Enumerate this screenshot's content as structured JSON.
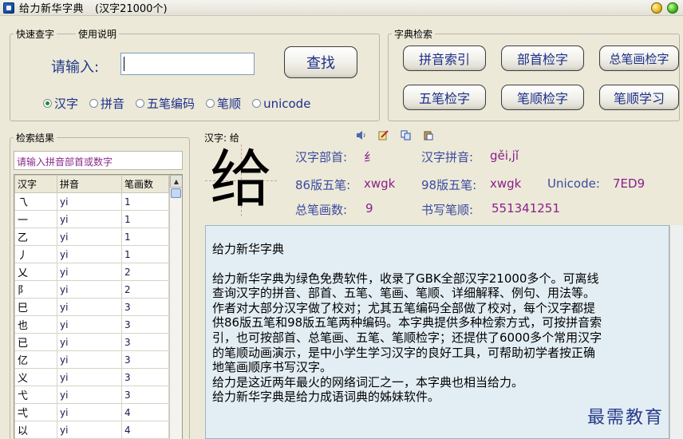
{
  "window": {
    "title": "给力新华字典",
    "subtitle": "(汉字21000个)"
  },
  "quick_search": {
    "group_label": "快速查字",
    "help_label": "使用说明",
    "input_label": "请输入:",
    "input_value": "",
    "search_button": "查找",
    "modes": [
      {
        "label": "汉字",
        "selected": true
      },
      {
        "label": "拼音",
        "selected": false
      },
      {
        "label": "五笔编码",
        "selected": false
      },
      {
        "label": "笔顺",
        "selected": false
      },
      {
        "label": "unicode",
        "selected": false
      }
    ]
  },
  "dict_search": {
    "group_label": "字典检索",
    "buttons": [
      "拼音索引",
      "部首检字",
      "总笔画检字",
      "五笔检字",
      "笔顺检字",
      "笔顺学习"
    ]
  },
  "results": {
    "group_label": "检索结果",
    "hint": "请输入拼音部首或数字",
    "columns": [
      "汉字",
      "拼音",
      "笔画数"
    ],
    "rows": [
      [
        "乁",
        "yi",
        "1"
      ],
      [
        "一",
        "yi",
        "1"
      ],
      [
        "乙",
        "yi",
        "1"
      ],
      [
        "丿",
        "yi",
        "1"
      ],
      [
        "乂",
        "yi",
        "2"
      ],
      [
        "阝",
        "yi",
        "2"
      ],
      [
        "巳",
        "yi",
        "3"
      ],
      [
        "也",
        "yi",
        "3"
      ],
      [
        "已",
        "yi",
        "3"
      ],
      [
        "亿",
        "yi",
        "3"
      ],
      [
        "义",
        "yi",
        "3"
      ],
      [
        "弋",
        "yi",
        "3"
      ],
      [
        "弌",
        "yi",
        "4"
      ],
      [
        "以",
        "yi",
        "4"
      ],
      [
        "艺",
        "yi",
        "4"
      ]
    ]
  },
  "detail": {
    "header": "汉字: 给",
    "character": "给",
    "radical_label": "汉字部首:",
    "radical_value": "纟",
    "pinyin_label": "汉字拼音:",
    "pinyin_value": "gěi,jǐ",
    "wubi86_label": "86版五笔:",
    "wubi86_value": "xwgk",
    "wubi98_label": "98版五笔:",
    "wubi98_value": "xwgk",
    "unicode_label": "Unicode:",
    "unicode_value": "7ED9",
    "strokes_label": "总笔画数:",
    "strokes_value": "9",
    "order_label": "书写笔顺:",
    "order_value": "551341251",
    "icons": [
      "speaker-icon",
      "edit-icon",
      "copy-icon",
      "paste-icon"
    ]
  },
  "description": {
    "title": "给力新华字典",
    "lines": [
      "给力新华字典为绿色免费软件，收录了GBK全部汉字21000多个。可离线",
      "查询汉字的拼音、部首、五笔、笔画、笔顺、详细解释、例句、用法等。",
      "作者对大部分汉字做了校对；尤其五笔编码全部做了校对，每个汉字都提",
      "供86版五笔和98版五笔两种编码。本字典提供多种检索方式，可按拼音索",
      "引，也可按部首、总笔画、五笔、笔顺检字；还提供了6000多个常用汉字",
      "的笔顺动画演示，是中小学生学习汉字的良好工具，可帮助初学者按正确",
      "地笔画顺序书写汉字。",
      "给力是这近两年最火的网络词汇之一，本字典也相当给力。",
      "给力新华字典是给力成语词典的姊妹软件。"
    ]
  },
  "watermark": "最需教育"
}
